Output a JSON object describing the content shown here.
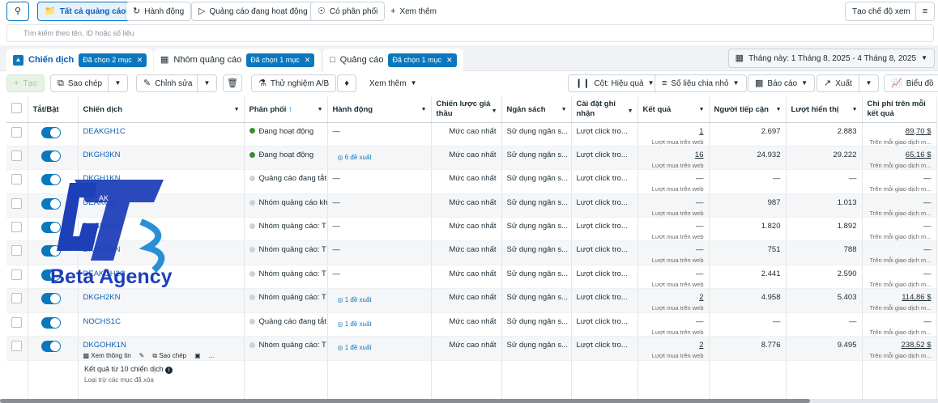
{
  "toolbar_top": {
    "all_ads": "Tất cả quảng cáo",
    "actions": "Hành động",
    "active_ads": "Quảng cáo đang hoạt động",
    "delivery": "Có phân phối",
    "see_more": "Xem thêm",
    "create_view": "Tạo chế độ xem"
  },
  "search": {
    "placeholder": "Tìm kiếm theo tên, ID hoặc số liệu"
  },
  "tabs": {
    "campaign": {
      "label": "Chiến dịch",
      "chip": "Đã chọn 2 mục"
    },
    "adset": {
      "label": "Nhóm quảng cáo",
      "chip": "Đã chọn 1 mục"
    },
    "ad": {
      "label": "Quảng cáo",
      "chip": "Đã chọn 1 mục"
    }
  },
  "date_range": "Tháng này: 1 Tháng 8, 2025 - 4 Tháng 8, 2025",
  "toolbar": {
    "create": "Tạo",
    "copy": "Sao chép",
    "edit": "Chỉnh sửa",
    "ab_test": "Thử nghiệm A/B",
    "see_more": "Xem thêm",
    "columns": "Cột: Hiệu quả",
    "breakdown": "Số liệu chia nhỏ",
    "reports": "Báo cáo",
    "export": "Xuất",
    "chart": "Biểu đồ"
  },
  "headers": {
    "toggle": "Tắt/Bật",
    "campaign": "Chiến dịch",
    "delivery": "Phân phối",
    "actions": "Hành động",
    "bid": "Chiến lược giá thầu",
    "budget": "Ngân sách",
    "attribution": "Cài đặt ghi nhận",
    "results": "Kết quả",
    "reach": "Người tiếp cận",
    "impressions": "Lượt hiển thị",
    "cost": "Chi phí trên mỗi kết quả"
  },
  "rows": [
    {
      "name": "DEAKGH1C",
      "delivery": "Đang hoạt động",
      "status": "green",
      "action": "—",
      "bid": "Mức cao nhất",
      "budget": "Sử dụng ngân s...",
      "attr": "Lượt click tro...",
      "result": "1",
      "result_sub": "Lượt mua trên web",
      "reach": "2.697",
      "impr": "2.883",
      "cost": "89,70 $",
      "cost_sub": "Trên mỗi giao dịch m..."
    },
    {
      "name": "DKGH3KN",
      "delivery": "Đang hoạt động",
      "status": "green",
      "action": "6 đề xuất",
      "bid": "Mức cao nhất",
      "budget": "Sử dụng ngân s...",
      "attr": "Lượt click tro...",
      "result": "16",
      "result_sub": "Lượt mua trên web",
      "reach": "24.932",
      "impr": "29.222",
      "cost": "65,16 $",
      "cost_sub": "Trên mỗi giao dịch m..."
    },
    {
      "name": "DKGH1KN",
      "delivery": "Quảng cáo đang tắt",
      "status": "gray",
      "action": "—",
      "bid": "Mức cao nhất",
      "budget": "Sử dụng ngân s...",
      "attr": "Lượt click tro...",
      "result": "—",
      "result_sub": "Lượt mua trên web",
      "reach": "—",
      "impr": "—",
      "cost": "—",
      "cost_sub": "Trên mỗi giao dịch m..."
    },
    {
      "name": "DEAKGH",
      "delivery": "Nhóm quảng cáo kh",
      "status": "gray",
      "action": "—",
      "bid": "Mức cao nhất",
      "budget": "Sử dụng ngân s...",
      "attr": "Lượt click tro...",
      "result": "—",
      "result_sub": "Lượt mua trên web",
      "reach": "987",
      "impr": "1.013",
      "cost": "—",
      "cost_sub": "Trên mỗi giao dịch m..."
    },
    {
      "name": "DKGH4KN",
      "delivery": "Nhóm quảng cáo: T",
      "status": "gray",
      "action": "—",
      "bid": "Mức cao nhất",
      "budget": "Sử dụng ngân s...",
      "attr": "Lượt click tro...",
      "result": "—",
      "result_sub": "Lượt mua trên web",
      "reach": "1.820",
      "impr": "1.892",
      "cost": "—",
      "cost_sub": "Trên mỗi giao dịch m..."
    },
    {
      "name": "DKGH5KN",
      "delivery": "Nhóm quảng cáo: T",
      "status": "gray",
      "action": "—",
      "bid": "Mức cao nhất",
      "budget": "Sử dụng ngân s...",
      "attr": "Lượt click tro...",
      "result": "—",
      "result_sub": "Lượt mua trên web",
      "reach": "751",
      "impr": "788",
      "cost": "—",
      "cost_sub": "Trên mỗi giao dịch m..."
    },
    {
      "name": "DEAKGH2C",
      "delivery": "Nhóm quảng cáo: T",
      "status": "gray",
      "action": "—",
      "bid": "Mức cao nhất",
      "budget": "Sử dụng ngân s...",
      "attr": "Lượt click tro...",
      "result": "—",
      "result_sub": "Lượt mua trên web",
      "reach": "2.441",
      "impr": "2.590",
      "cost": "—",
      "cost_sub": "Trên mỗi giao dịch m..."
    },
    {
      "name": "DKGH2KN",
      "delivery": "Nhóm quảng cáo: T",
      "status": "gray",
      "action": "1 đề xuất",
      "bid": "Mức cao nhất",
      "budget": "Sử dụng ngân s...",
      "attr": "Lượt click tro...",
      "result": "2",
      "result_sub": "Lượt mua trên web",
      "reach": "4.958",
      "impr": "5.403",
      "cost": "114,86 $",
      "cost_sub": "Trên mỗi giao dịch m..."
    },
    {
      "name": "NOCHS1C",
      "delivery": "Quảng cáo đang tắt",
      "status": "gray",
      "action": "1 đề xuất",
      "bid": "Mức cao nhất",
      "budget": "Sử dụng ngân s...",
      "attr": "Lượt click tro...",
      "result": "—",
      "result_sub": "Lượt mua trên web",
      "reach": "—",
      "impr": "—",
      "cost": "—",
      "cost_sub": "Trên mỗi giao dịch m..."
    },
    {
      "name": "DKGOHK1N",
      "delivery": "Nhóm quảng cáo: T",
      "status": "gray",
      "action": "1 đề xuất",
      "bid": "Mức cao nhất",
      "budget": "Sử dụng ngân s...",
      "attr": "Lượt click tro...",
      "result": "2",
      "result_sub": "Lượt mua trên web",
      "reach": "8.776",
      "impr": "9.495",
      "cost": "238,52 $",
      "cost_sub": "Trên mỗi giao dịch m..."
    }
  ],
  "row_actions": {
    "view": "Xem thông tin",
    "copy": "Sao chép",
    "more": "..."
  },
  "footer": {
    "summary": "Kết quả từ 10 chiến dịch",
    "excluded": "Loại trừ các mục đã xóa"
  },
  "watermark": {
    "text": "Beta Agency",
    "initials": "AK"
  }
}
